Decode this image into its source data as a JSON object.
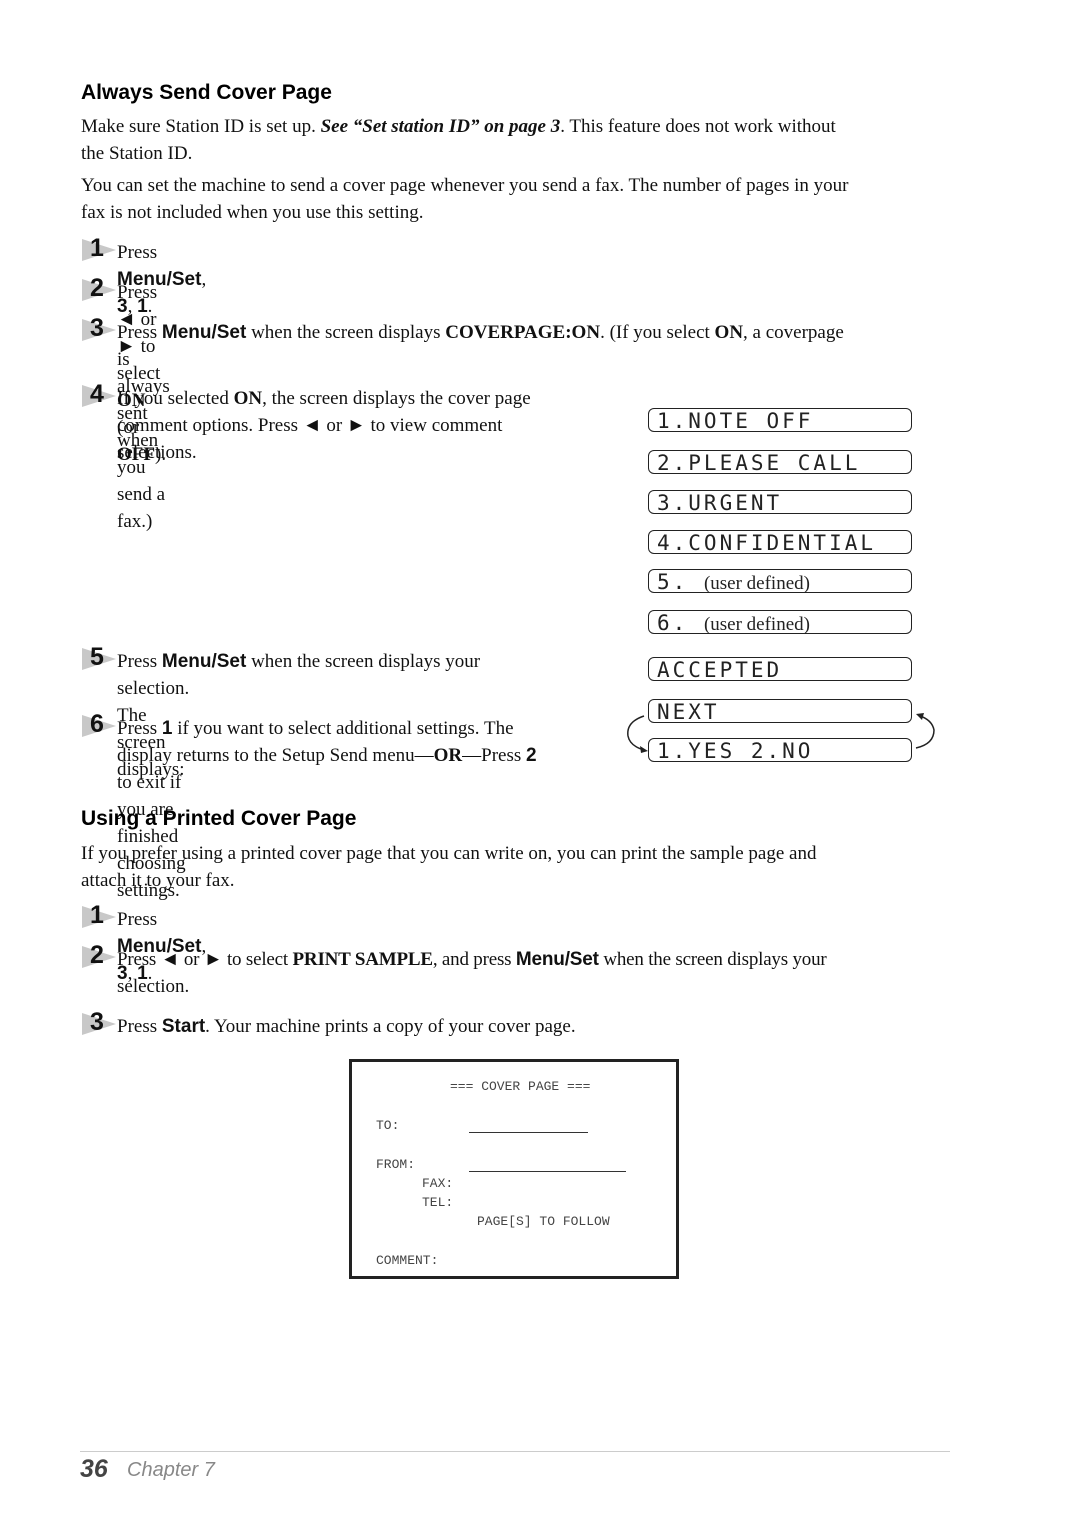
{
  "section1": {
    "heading": "Always Send Cover Page",
    "para1": {
      "text_a": "Make sure Station ID is set up. ",
      "xref": "See “Set station ID” on page 3",
      "text_b": ". This feature does not work without",
      "line2": "the Station ID."
    },
    "para2": {
      "line1": "You can set the machine to send a cover page whenever you send a fax. The number of pages in your",
      "line2": "fax is not included when you use this setting."
    },
    "steps": [
      {
        "num": "1",
        "pre": "Press ",
        "key": "Menu/Set",
        "mid": ", ",
        "k2": "3",
        "sep": ", ",
        "k3": "1",
        "end": "."
      },
      {
        "num": "2",
        "pre": "Press ",
        "left": "◄",
        "or": " or ",
        "right": "►",
        "mid": " to select ",
        "on": "ON",
        "paren": " (or ",
        "off": "OFF",
        "end": ")."
      },
      {
        "num": "3",
        "pre": "Press ",
        "key": "Menu/Set",
        "mid": " when the screen displays ",
        "disp": "COVERPAGE:ON",
        "mid2": ". (If you select ",
        "on": "ON",
        "end": ", a coverpage",
        "line2": "is always sent when you send a fax.)"
      },
      {
        "num": "4",
        "pre": "If you selected ",
        "on": "ON",
        "end": ", the screen displays the cover page",
        "line2a": "comment options. Press ",
        "left": "◄",
        "or": " or ",
        "right": "►",
        "line2b": " to view comment",
        "line3": "selections."
      },
      {
        "num": "5",
        "pre": "Press ",
        "key": "Menu/Set",
        "end": " when the screen displays your",
        "line2": "selection. The screen displays:"
      },
      {
        "num": "6",
        "pre": "Press ",
        "key": "1",
        "end": " if you want to select additional settings. The",
        "line2a": "display returns to the Setup Send menu—",
        "or": "OR",
        "line2b": "—Press ",
        "key2": "2",
        "line3": "to exit if you are finished choosing settings."
      }
    ],
    "lcd_options": [
      {
        "code": "1.NOTE OFF",
        "desc": ""
      },
      {
        "code": "2.PLEASE CALL",
        "desc": ""
      },
      {
        "code": "3.URGENT",
        "desc": ""
      },
      {
        "code": "4.CONFIDENTIAL",
        "desc": ""
      },
      {
        "code": "5. ",
        "desc": "(user defined)"
      },
      {
        "code": "6. ",
        "desc": "(user defined)"
      }
    ],
    "lcd_accepted": "ACCEPTED",
    "lcd_next": "NEXT",
    "lcd_yesno": "1.YES 2.NO"
  },
  "section2": {
    "heading": "Using a Printed Cover Page",
    "para": {
      "line1": "If you prefer using a printed cover page that you can write on, you can print the sample page and",
      "line2": "attach it to your fax."
    },
    "steps": [
      {
        "num": "1",
        "pre": "Press ",
        "key": "Menu/Set",
        "mid": ", ",
        "k2": "3",
        "sep": ", ",
        "k3": "1",
        "end": "."
      },
      {
        "num": "2",
        "pre": "Press ",
        "left": "◄",
        "or": " or ",
        "right": "►",
        "mid": " to select ",
        "disp": "PRINT SAMPLE",
        "mid2": ", and press ",
        "key": "Menu/Set",
        "end": " when the screen displays your",
        "line2": "selection."
      },
      {
        "num": "3",
        "pre": "Press ",
        "key": "Start",
        "end": ". Your machine prints a copy of your cover page."
      }
    ],
    "cover_sample": {
      "title": "=== COVER PAGE ===",
      "to": "TO:",
      "from": "FROM:",
      "fax": "FAX:",
      "tel": "TEL:",
      "pages": "PAGE[S] TO FOLLOW",
      "comment": "COMMENT:"
    }
  },
  "footer": {
    "page_number": "36",
    "chapter": "Chapter 7"
  }
}
